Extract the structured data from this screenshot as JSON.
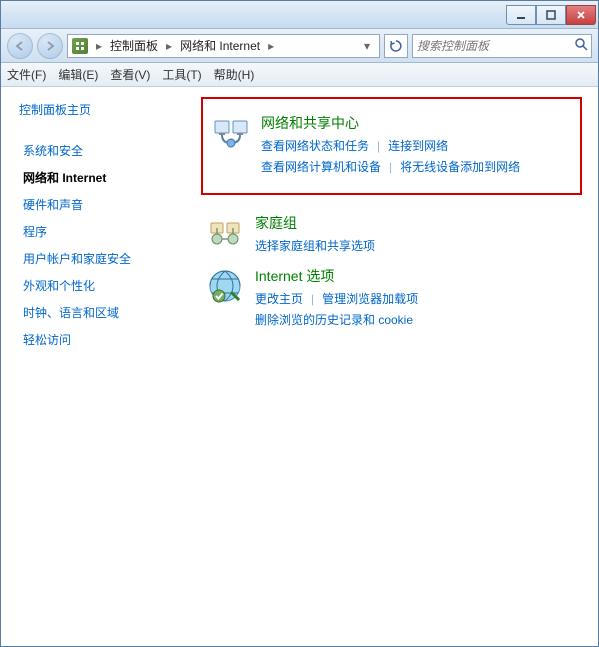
{
  "breadcrumb": {
    "item1": "控制面板",
    "item2": "网络和 Internet"
  },
  "search": {
    "placeholder": "搜索控制面板"
  },
  "menu": {
    "file": "文件(F)",
    "edit": "编辑(E)",
    "view": "查看(V)",
    "tools": "工具(T)",
    "help": "帮助(H)"
  },
  "sidebar": {
    "heading": "控制面板主页",
    "items": [
      "系统和安全",
      "网络和 Internet",
      "硬件和声音",
      "程序",
      "用户帐户和家庭安全",
      "外观和个性化",
      "时钟、语言和区域",
      "轻松访问"
    ],
    "activeIndex": 1
  },
  "categories": [
    {
      "title": "网络和共享中心",
      "links": [
        "查看网络状态和任务",
        "连接到网络",
        "查看网络计算机和设备",
        "将无线设备添加到网络"
      ],
      "highlighted": true
    },
    {
      "title": "家庭组",
      "links": [
        "选择家庭组和共享选项"
      ]
    },
    {
      "title": "Internet 选项",
      "links": [
        "更改主页",
        "管理浏览器加载项",
        "删除浏览的历史记录和 cookie"
      ]
    }
  ]
}
